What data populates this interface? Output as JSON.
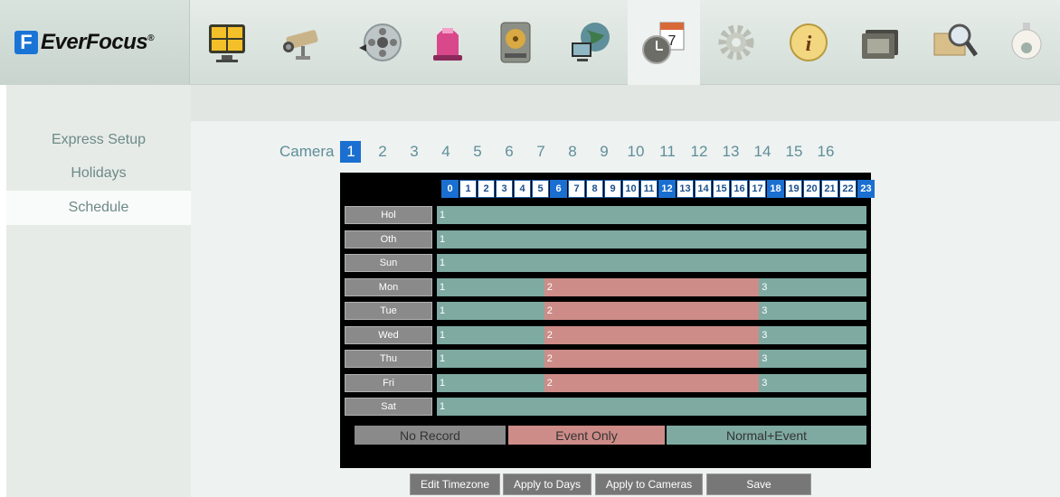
{
  "header": {
    "logo_letter": "F",
    "logo_text": "EverFocus",
    "logo_mark": "®",
    "nav_icons": [
      {
        "name": "live-view-icon",
        "active": false
      },
      {
        "name": "camera-icon",
        "active": false
      },
      {
        "name": "video-reel-icon",
        "active": false
      },
      {
        "name": "alarm-siren-icon",
        "active": false
      },
      {
        "name": "hard-drive-icon",
        "active": false
      },
      {
        "name": "network-globe-icon",
        "active": false
      },
      {
        "name": "schedule-clock-calendar-icon",
        "active": true
      },
      {
        "name": "settings-gear-icon",
        "active": false
      },
      {
        "name": "info-icon",
        "active": false
      },
      {
        "name": "film-playback-icon",
        "active": false
      },
      {
        "name": "search-folder-icon",
        "active": false
      },
      {
        "name": "dome-camera-icon",
        "active": false
      }
    ],
    "calendar_day": "7"
  },
  "sidebar": {
    "items": [
      {
        "label": "Express Setup",
        "active": false
      },
      {
        "label": "Holidays",
        "active": false
      },
      {
        "label": "Schedule",
        "active": true
      }
    ]
  },
  "camera_selector": {
    "label": "Camera",
    "numbers": [
      "1",
      "2",
      "3",
      "4",
      "5",
      "6",
      "7",
      "8",
      "9",
      "10",
      "11",
      "12",
      "13",
      "14",
      "15",
      "16"
    ],
    "selected": "1"
  },
  "schedule": {
    "hours": [
      "0",
      "1",
      "2",
      "3",
      "4",
      "5",
      "6",
      "7",
      "8",
      "9",
      "10",
      "11",
      "12",
      "13",
      "14",
      "15",
      "16",
      "17",
      "18",
      "19",
      "20",
      "21",
      "22",
      "23"
    ],
    "highlight_hours": [
      "0",
      "6",
      "12",
      "18",
      "23"
    ],
    "rows": [
      {
        "day": "Hol",
        "segments": [
          {
            "label": "1",
            "mode": "normal",
            "start": 0,
            "end": 24
          }
        ]
      },
      {
        "day": "Oth",
        "segments": [
          {
            "label": "1",
            "mode": "normal",
            "start": 0,
            "end": 24
          }
        ]
      },
      {
        "day": "Sun",
        "segments": [
          {
            "label": "1",
            "mode": "normal",
            "start": 0,
            "end": 24
          }
        ]
      },
      {
        "day": "Mon",
        "segments": [
          {
            "label": "1",
            "mode": "normal",
            "start": 0,
            "end": 6
          },
          {
            "label": "2",
            "mode": "event",
            "start": 6,
            "end": 18
          },
          {
            "label": "3",
            "mode": "normal",
            "start": 18,
            "end": 24
          }
        ]
      },
      {
        "day": "Tue",
        "segments": [
          {
            "label": "1",
            "mode": "normal",
            "start": 0,
            "end": 6
          },
          {
            "label": "2",
            "mode": "event",
            "start": 6,
            "end": 18
          },
          {
            "label": "3",
            "mode": "normal",
            "start": 18,
            "end": 24
          }
        ]
      },
      {
        "day": "Wed",
        "segments": [
          {
            "label": "1",
            "mode": "normal",
            "start": 0,
            "end": 6
          },
          {
            "label": "2",
            "mode": "event",
            "start": 6,
            "end": 18
          },
          {
            "label": "3",
            "mode": "normal",
            "start": 18,
            "end": 24
          }
        ]
      },
      {
        "day": "Thu",
        "segments": [
          {
            "label": "1",
            "mode": "normal",
            "start": 0,
            "end": 6
          },
          {
            "label": "2",
            "mode": "event",
            "start": 6,
            "end": 18
          },
          {
            "label": "3",
            "mode": "normal",
            "start": 18,
            "end": 24
          }
        ]
      },
      {
        "day": "Fri",
        "segments": [
          {
            "label": "1",
            "mode": "normal",
            "start": 0,
            "end": 6
          },
          {
            "label": "2",
            "mode": "event",
            "start": 6,
            "end": 18
          },
          {
            "label": "3",
            "mode": "normal",
            "start": 18,
            "end": 24
          }
        ]
      },
      {
        "day": "Sat",
        "segments": [
          {
            "label": "1",
            "mode": "normal",
            "start": 0,
            "end": 24
          }
        ]
      }
    ],
    "legend": {
      "no_record": "No Record",
      "event_only": "Event Only",
      "normal_event": "Normal+Event"
    },
    "colors": {
      "normal": "#7eaaa2",
      "event": "#cd8c88",
      "no_record": "#8a8a8a",
      "accent": "#1a6fd0"
    }
  },
  "buttons": {
    "edit_timezone": "Edit Timezone",
    "apply_days": "Apply to Days",
    "apply_cameras": "Apply to Cameras",
    "save": "Save"
  }
}
